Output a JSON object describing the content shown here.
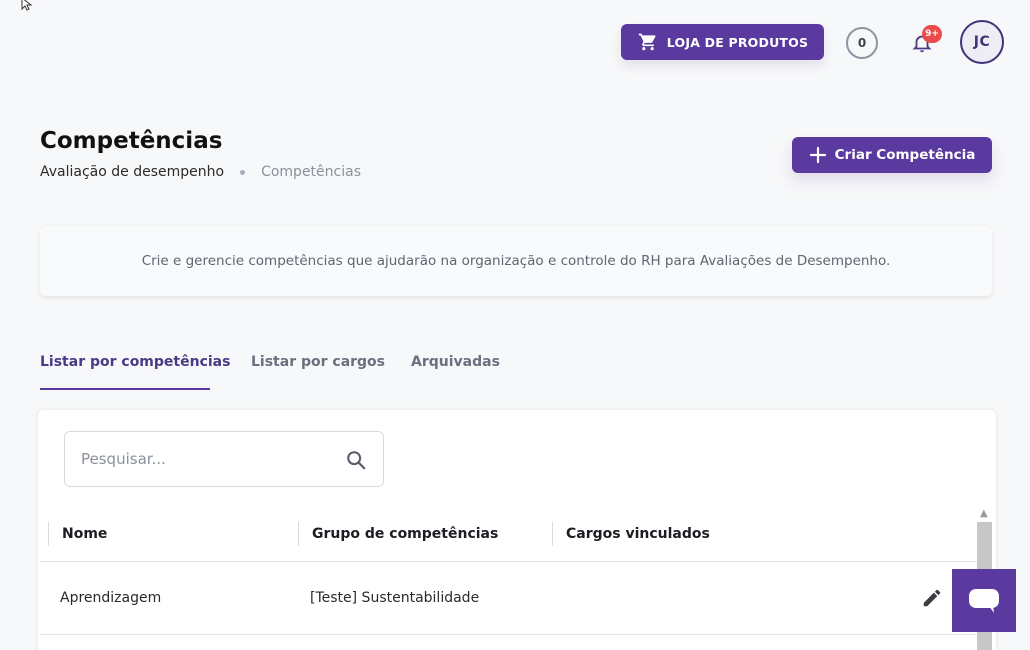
{
  "header": {
    "store_label": "LOJA DE PRODUTOS",
    "counter": "0",
    "notifications_badge": "9+",
    "avatar_initials": "JC"
  },
  "page": {
    "title": "Competências",
    "breadcrumb": [
      "Avaliação de desempenho",
      "Competências"
    ],
    "create_label": "Criar Competência",
    "description": "Crie e gerencie competências que ajudarão na organização e controle do RH para Avaliações de Desempenho."
  },
  "tabs": [
    {
      "label": "Listar por competências",
      "active": true
    },
    {
      "label": "Listar por cargos",
      "active": false
    },
    {
      "label": "Arquivadas",
      "active": false
    }
  ],
  "search": {
    "placeholder": "Pesquisar..."
  },
  "table": {
    "columns": [
      "Nome",
      "Grupo de competências",
      "Cargos vinculados"
    ],
    "rows": [
      {
        "nome": "Aprendizagem",
        "grupo": "[Teste] Sustentabilidade",
        "cargos": ""
      }
    ]
  },
  "colors": {
    "accent": "#5a3a9e",
    "badge": "#ea4b4b"
  }
}
